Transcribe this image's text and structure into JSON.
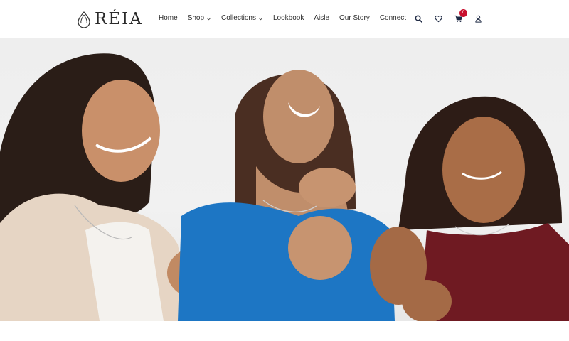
{
  "brand": {
    "name": "RÉIA",
    "logo_icon": "teardrop-logo-icon"
  },
  "nav": {
    "items": [
      {
        "label": "Home",
        "has_dropdown": false
      },
      {
        "label": "Shop",
        "has_dropdown": true
      },
      {
        "label": "Collections",
        "has_dropdown": true
      },
      {
        "label": "Lookbook",
        "has_dropdown": false
      },
      {
        "label": "Aisle",
        "has_dropdown": false
      },
      {
        "label": "Our Story",
        "has_dropdown": false
      },
      {
        "label": "Connect",
        "has_dropdown": false
      }
    ]
  },
  "header_icons": {
    "search": "search-icon",
    "wishlist": "heart-icon",
    "cart": "cart-icon",
    "cart_count": "0",
    "account": "user-icon"
  },
  "hero": {
    "image": "three smiling women wearing silver jewellery"
  },
  "colors": {
    "badge": "#c8102e",
    "text": "#2b2b2b",
    "background": "#ffffff"
  }
}
